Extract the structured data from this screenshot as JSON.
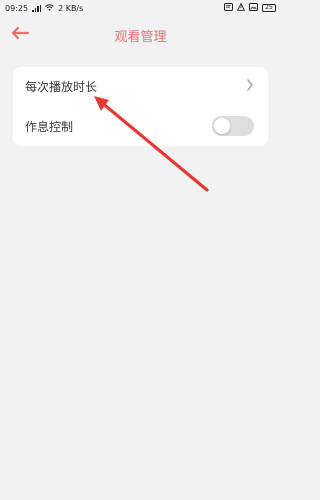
{
  "status_bar": {
    "time": "09:25",
    "network_speed": "2 KB/s",
    "battery": "25",
    "icons": [
      "signal-icon",
      "wifi-icon",
      "notification-icon",
      "battery-icon"
    ]
  },
  "top_bar": {
    "title": "观看管理",
    "back_icon": "back-arrow-icon"
  },
  "settings": {
    "items": [
      {
        "label": "每次播放时长",
        "type": "navigation",
        "icon": "chevron-right-icon"
      },
      {
        "label": "作息控制",
        "type": "toggle",
        "enabled": false
      }
    ]
  },
  "annotation": {
    "type": "arrow",
    "color": "#e53935"
  },
  "colors": {
    "accent": "#ea6f6f",
    "background": "#f2f2f2",
    "card": "#ffffff",
    "toggle_off": "#dddddd"
  }
}
